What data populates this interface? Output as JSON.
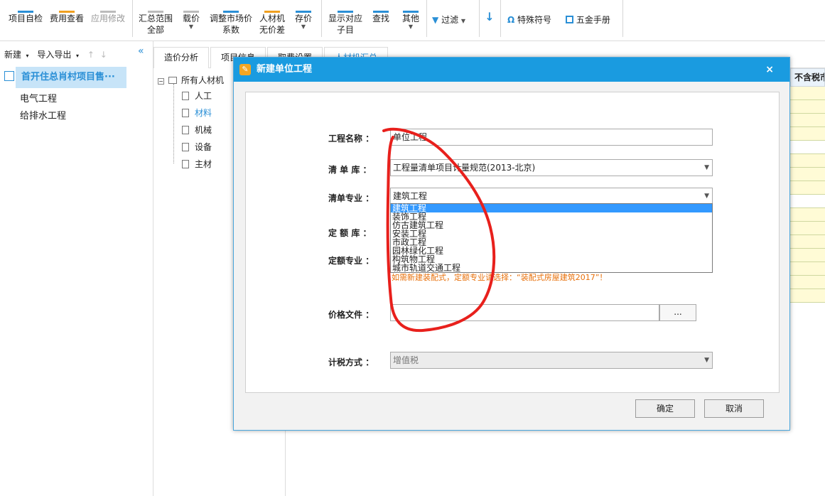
{
  "toolbar": {
    "buttons": [
      {
        "label": "项目自检"
      },
      {
        "label": "费用查看"
      },
      {
        "label": "应用修改"
      },
      {
        "label": "汇总范围",
        "sub": "全部"
      },
      {
        "label": "载价"
      },
      {
        "label": "调整市场价",
        "sub": "系数"
      },
      {
        "label": "人材机",
        "sub": "无价差"
      },
      {
        "label": "存价"
      },
      {
        "label": "显示对应",
        "sub": "子目"
      },
      {
        "label": "查找"
      },
      {
        "label": "其他"
      },
      {
        "label": "过滤"
      },
      {
        "label": "特殊符号"
      },
      {
        "label": "五金手册"
      }
    ]
  },
  "left_panel": {
    "new_label": "新建",
    "import_export_label": "导入导出",
    "collapse_glyph": "«",
    "project_name": "首开住总肖村项目售···",
    "items": [
      "电气工程",
      "给排水工程"
    ]
  },
  "tabs": [
    "造价分析",
    "项目信息",
    "取费设置",
    "人材机汇总"
  ],
  "resource_tree": {
    "root": "所有人材机",
    "items": [
      "人工",
      "材料",
      "机械",
      "设备",
      "主材"
    ]
  },
  "grid": {
    "header": "不含税市"
  },
  "dialog": {
    "title": "新建单位工程",
    "close": "×",
    "fields": {
      "project_name_label": "工程名称 ：",
      "project_name_value": "单位工程",
      "list_lib_label": "清 单 库 ：",
      "list_lib_value": "工程量清单项目计量规范(2013-北京)",
      "list_major_label": "清单专业 ：",
      "list_major_value": "建筑工程",
      "quota_lib_label": "定 额 库 ：",
      "quota_major_label": "定额专业 ：",
      "price_file_label": "价格文件 ：",
      "price_file_value": "",
      "browse_label": "...",
      "tax_label": "计税方式 ：",
      "tax_value": "增值税"
    },
    "dropdown_options": [
      "建筑工程",
      "装饰工程",
      "仿古建筑工程",
      "安装工程",
      "市政工程",
      "园林绿化工程",
      "构筑物工程",
      "城市轨道交通工程"
    ],
    "hint": "如需新建装配式，定额专业请选择：“装配式房屋建筑2017”！",
    "ok_label": "确定",
    "cancel_label": "取消"
  },
  "colors": {
    "accent": "#1a9be0",
    "selection": "#3399ff",
    "hint": "#e8700a",
    "annotation": "#e8201c"
  }
}
